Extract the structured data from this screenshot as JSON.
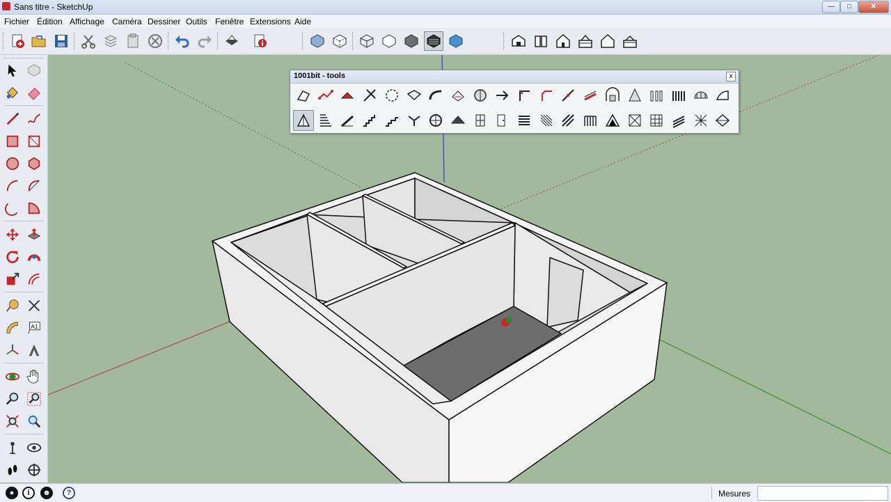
{
  "window": {
    "title": "Sans titre - SketchUp"
  },
  "menu": [
    "Fichier",
    "Édition",
    "Affichage",
    "Caméra",
    "Dessiner",
    "Outils",
    "Fenêtre",
    "Extensions",
    "Aide"
  ],
  "main_toolbar": [
    {
      "name": "new-icon",
      "color": "#c8262b"
    },
    {
      "name": "open-folder-icon",
      "color": "#3e7fbf"
    },
    {
      "name": "save-icon",
      "color": "#2f5d9a"
    },
    {
      "name": "cut-icon",
      "color": "#777777"
    },
    {
      "name": "copy-icon",
      "color": "#888888"
    },
    {
      "name": "paste-icon",
      "color": "#888888"
    },
    {
      "name": "erase-icon",
      "color": "#888888"
    },
    {
      "name": "undo-icon",
      "color": "#2a6cc0"
    },
    {
      "name": "redo-icon",
      "color": "#999999"
    },
    {
      "name": "print-icon",
      "color": "#333333"
    },
    {
      "name": "model-info-icon",
      "color": "#c8262b"
    }
  ],
  "style_toolbar": [
    "x-ray-icon",
    "back-edges-icon",
    "wireframe-icon",
    "hidden-line-icon",
    "shaded-icon",
    "shaded-textures-icon",
    "monochrome-icon"
  ],
  "views_toolbar": [
    "iso-view-icon",
    "top-view-icon",
    "front-view-icon",
    "right-view-icon",
    "back-view-icon",
    "left-view-icon"
  ],
  "left_toolbar": [
    [
      "select-icon",
      "component-icon"
    ],
    [
      "paint-bucket-icon",
      "eraser-icon"
    ],
    [
      "pencil-line-icon",
      "freehand-icon"
    ],
    [
      "rectangle-icon",
      "rotated-rectangle-icon"
    ],
    [
      "circle-icon",
      "polygon-icon"
    ],
    [
      "arc-icon",
      "two-point-arc-icon"
    ],
    [
      "three-point-arc-icon",
      "pie-icon"
    ],
    [
      "move-icon",
      "push-pull-icon"
    ],
    [
      "rotate-icon",
      "follow-me-icon"
    ],
    [
      "scale-icon",
      "offset-icon"
    ],
    [
      "tape-measure-icon",
      "dimension-icon"
    ],
    [
      "protractor-icon",
      "text-icon"
    ],
    [
      "axes-icon",
      "3d-text-icon"
    ],
    [
      "orbit-icon",
      "pan-icon"
    ],
    [
      "zoom-icon",
      "zoom-window-icon"
    ],
    [
      "zoom-extents-icon",
      "previous-view-icon"
    ],
    [
      "position-camera-icon",
      "look-around-icon"
    ],
    [
      "walk-icon",
      "section-plane-icon"
    ]
  ],
  "panel": {
    "title": "1001bit - tools",
    "close": "x",
    "row1": [
      "point-tool-icon",
      "polyline-icon",
      "fillet-icon",
      "extend-icon",
      "circle-center-icon",
      "offset-face-icon",
      "curve-icon",
      "divide-icon",
      "arc-fit-icon",
      "angle-icon",
      "chamfer-icon",
      "corner-icon",
      "line-divide-icon",
      "slope-icon",
      "arch-icon",
      "pyramid-icon",
      "pillars-icon",
      "columns-icon",
      "dome-icon",
      "curved-wall-icon"
    ],
    "row2": [
      "wall-tool-icon",
      "stairs-icon",
      "ramp-icon",
      "stair-straight-icon",
      "stair-l-icon",
      "stair-split-icon",
      "spiral-stair-icon",
      "roof-icon",
      "window-icon",
      "door-icon",
      "louvre-icon",
      "grating-icon",
      "rafter-icon",
      "joists-icon",
      "truss-icon",
      "mesh-icon",
      "tile-icon",
      "deck-icon",
      "lattice-icon",
      "hip-roof-icon"
    ],
    "selected_row2_index": 0
  },
  "status": {
    "icons": [
      "geo-location-icon",
      "credits-icon",
      "user-icon",
      "help-icon"
    ],
    "help_glyph": "?",
    "credit_glyph": "i",
    "measures_label": "Mesures",
    "measures_value": ""
  },
  "colors": {
    "ground": "#a3b99c",
    "wall": "#e9e9e9",
    "floor": "#6d6d6d",
    "axis_red": "#b03a3a",
    "axis_green": "#2e8a2e",
    "axis_blue": "#2a3fc0"
  }
}
